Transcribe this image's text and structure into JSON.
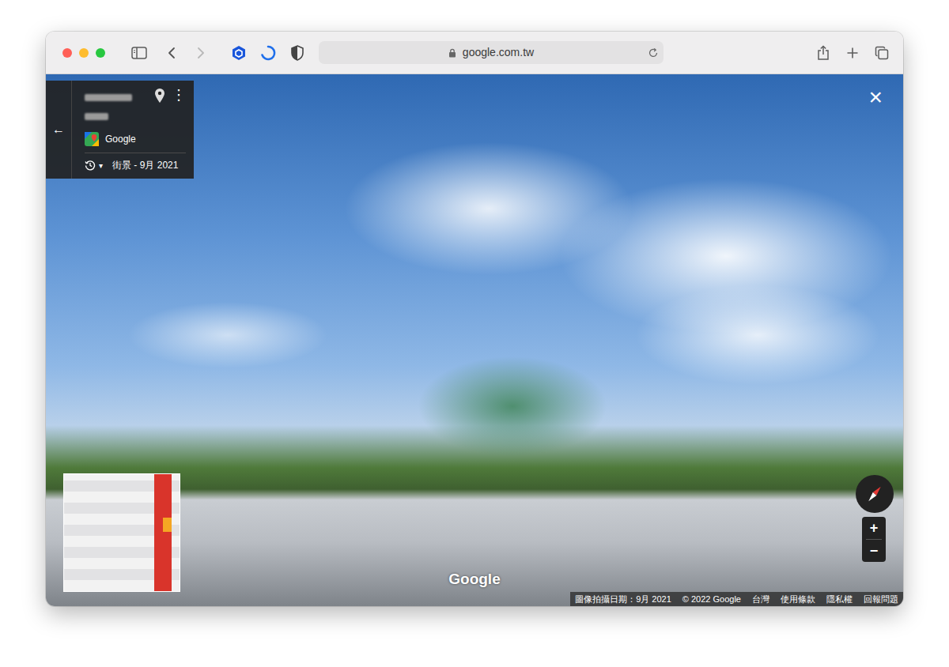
{
  "browser": {
    "url": "google.com.tw",
    "nav": {
      "back_disabled": false,
      "forward_disabled": true
    }
  },
  "panel": {
    "back": "←",
    "more": "⋮",
    "source": "Google",
    "history_caret": "▾",
    "date": "街景 - 9月 2021"
  },
  "viewer": {
    "close": "×",
    "watermark": "Google",
    "zoom_in": "+",
    "zoom_out": "−"
  },
  "footer": [
    "圖像拍攝日期：9月 2021",
    "© 2022 Google",
    "台灣",
    "使用條款",
    "隱私權",
    "回報問題"
  ]
}
